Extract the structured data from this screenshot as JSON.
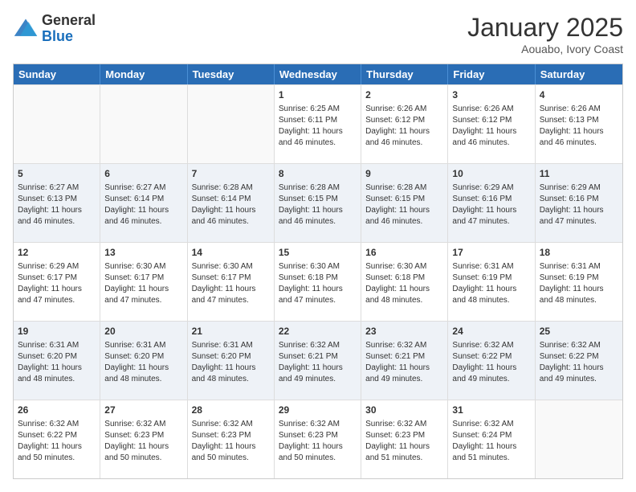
{
  "header": {
    "logo_general": "General",
    "logo_blue": "Blue",
    "month_title": "January 2025",
    "location": "Aouabo, Ivory Coast"
  },
  "days_of_week": [
    "Sunday",
    "Monday",
    "Tuesday",
    "Wednesday",
    "Thursday",
    "Friday",
    "Saturday"
  ],
  "weeks": [
    [
      {
        "day": "",
        "info": ""
      },
      {
        "day": "",
        "info": ""
      },
      {
        "day": "",
        "info": ""
      },
      {
        "day": "1",
        "info": "Sunrise: 6:25 AM\nSunset: 6:11 PM\nDaylight: 11 hours and 46 minutes."
      },
      {
        "day": "2",
        "info": "Sunrise: 6:26 AM\nSunset: 6:12 PM\nDaylight: 11 hours and 46 minutes."
      },
      {
        "day": "3",
        "info": "Sunrise: 6:26 AM\nSunset: 6:12 PM\nDaylight: 11 hours and 46 minutes."
      },
      {
        "day": "4",
        "info": "Sunrise: 6:26 AM\nSunset: 6:13 PM\nDaylight: 11 hours and 46 minutes."
      }
    ],
    [
      {
        "day": "5",
        "info": "Sunrise: 6:27 AM\nSunset: 6:13 PM\nDaylight: 11 hours and 46 minutes."
      },
      {
        "day": "6",
        "info": "Sunrise: 6:27 AM\nSunset: 6:14 PM\nDaylight: 11 hours and 46 minutes."
      },
      {
        "day": "7",
        "info": "Sunrise: 6:28 AM\nSunset: 6:14 PM\nDaylight: 11 hours and 46 minutes."
      },
      {
        "day": "8",
        "info": "Sunrise: 6:28 AM\nSunset: 6:15 PM\nDaylight: 11 hours and 46 minutes."
      },
      {
        "day": "9",
        "info": "Sunrise: 6:28 AM\nSunset: 6:15 PM\nDaylight: 11 hours and 46 minutes."
      },
      {
        "day": "10",
        "info": "Sunrise: 6:29 AM\nSunset: 6:16 PM\nDaylight: 11 hours and 47 minutes."
      },
      {
        "day": "11",
        "info": "Sunrise: 6:29 AM\nSunset: 6:16 PM\nDaylight: 11 hours and 47 minutes."
      }
    ],
    [
      {
        "day": "12",
        "info": "Sunrise: 6:29 AM\nSunset: 6:17 PM\nDaylight: 11 hours and 47 minutes."
      },
      {
        "day": "13",
        "info": "Sunrise: 6:30 AM\nSunset: 6:17 PM\nDaylight: 11 hours and 47 minutes."
      },
      {
        "day": "14",
        "info": "Sunrise: 6:30 AM\nSunset: 6:17 PM\nDaylight: 11 hours and 47 minutes."
      },
      {
        "day": "15",
        "info": "Sunrise: 6:30 AM\nSunset: 6:18 PM\nDaylight: 11 hours and 47 minutes."
      },
      {
        "day": "16",
        "info": "Sunrise: 6:30 AM\nSunset: 6:18 PM\nDaylight: 11 hours and 48 minutes."
      },
      {
        "day": "17",
        "info": "Sunrise: 6:31 AM\nSunset: 6:19 PM\nDaylight: 11 hours and 48 minutes."
      },
      {
        "day": "18",
        "info": "Sunrise: 6:31 AM\nSunset: 6:19 PM\nDaylight: 11 hours and 48 minutes."
      }
    ],
    [
      {
        "day": "19",
        "info": "Sunrise: 6:31 AM\nSunset: 6:20 PM\nDaylight: 11 hours and 48 minutes."
      },
      {
        "day": "20",
        "info": "Sunrise: 6:31 AM\nSunset: 6:20 PM\nDaylight: 11 hours and 48 minutes."
      },
      {
        "day": "21",
        "info": "Sunrise: 6:31 AM\nSunset: 6:20 PM\nDaylight: 11 hours and 48 minutes."
      },
      {
        "day": "22",
        "info": "Sunrise: 6:32 AM\nSunset: 6:21 PM\nDaylight: 11 hours and 49 minutes."
      },
      {
        "day": "23",
        "info": "Sunrise: 6:32 AM\nSunset: 6:21 PM\nDaylight: 11 hours and 49 minutes."
      },
      {
        "day": "24",
        "info": "Sunrise: 6:32 AM\nSunset: 6:22 PM\nDaylight: 11 hours and 49 minutes."
      },
      {
        "day": "25",
        "info": "Sunrise: 6:32 AM\nSunset: 6:22 PM\nDaylight: 11 hours and 49 minutes."
      }
    ],
    [
      {
        "day": "26",
        "info": "Sunrise: 6:32 AM\nSunset: 6:22 PM\nDaylight: 11 hours and 50 minutes."
      },
      {
        "day": "27",
        "info": "Sunrise: 6:32 AM\nSunset: 6:23 PM\nDaylight: 11 hours and 50 minutes."
      },
      {
        "day": "28",
        "info": "Sunrise: 6:32 AM\nSunset: 6:23 PM\nDaylight: 11 hours and 50 minutes."
      },
      {
        "day": "29",
        "info": "Sunrise: 6:32 AM\nSunset: 6:23 PM\nDaylight: 11 hours and 50 minutes."
      },
      {
        "day": "30",
        "info": "Sunrise: 6:32 AM\nSunset: 6:23 PM\nDaylight: 11 hours and 51 minutes."
      },
      {
        "day": "31",
        "info": "Sunrise: 6:32 AM\nSunset: 6:24 PM\nDaylight: 11 hours and 51 minutes."
      },
      {
        "day": "",
        "info": ""
      }
    ]
  ]
}
